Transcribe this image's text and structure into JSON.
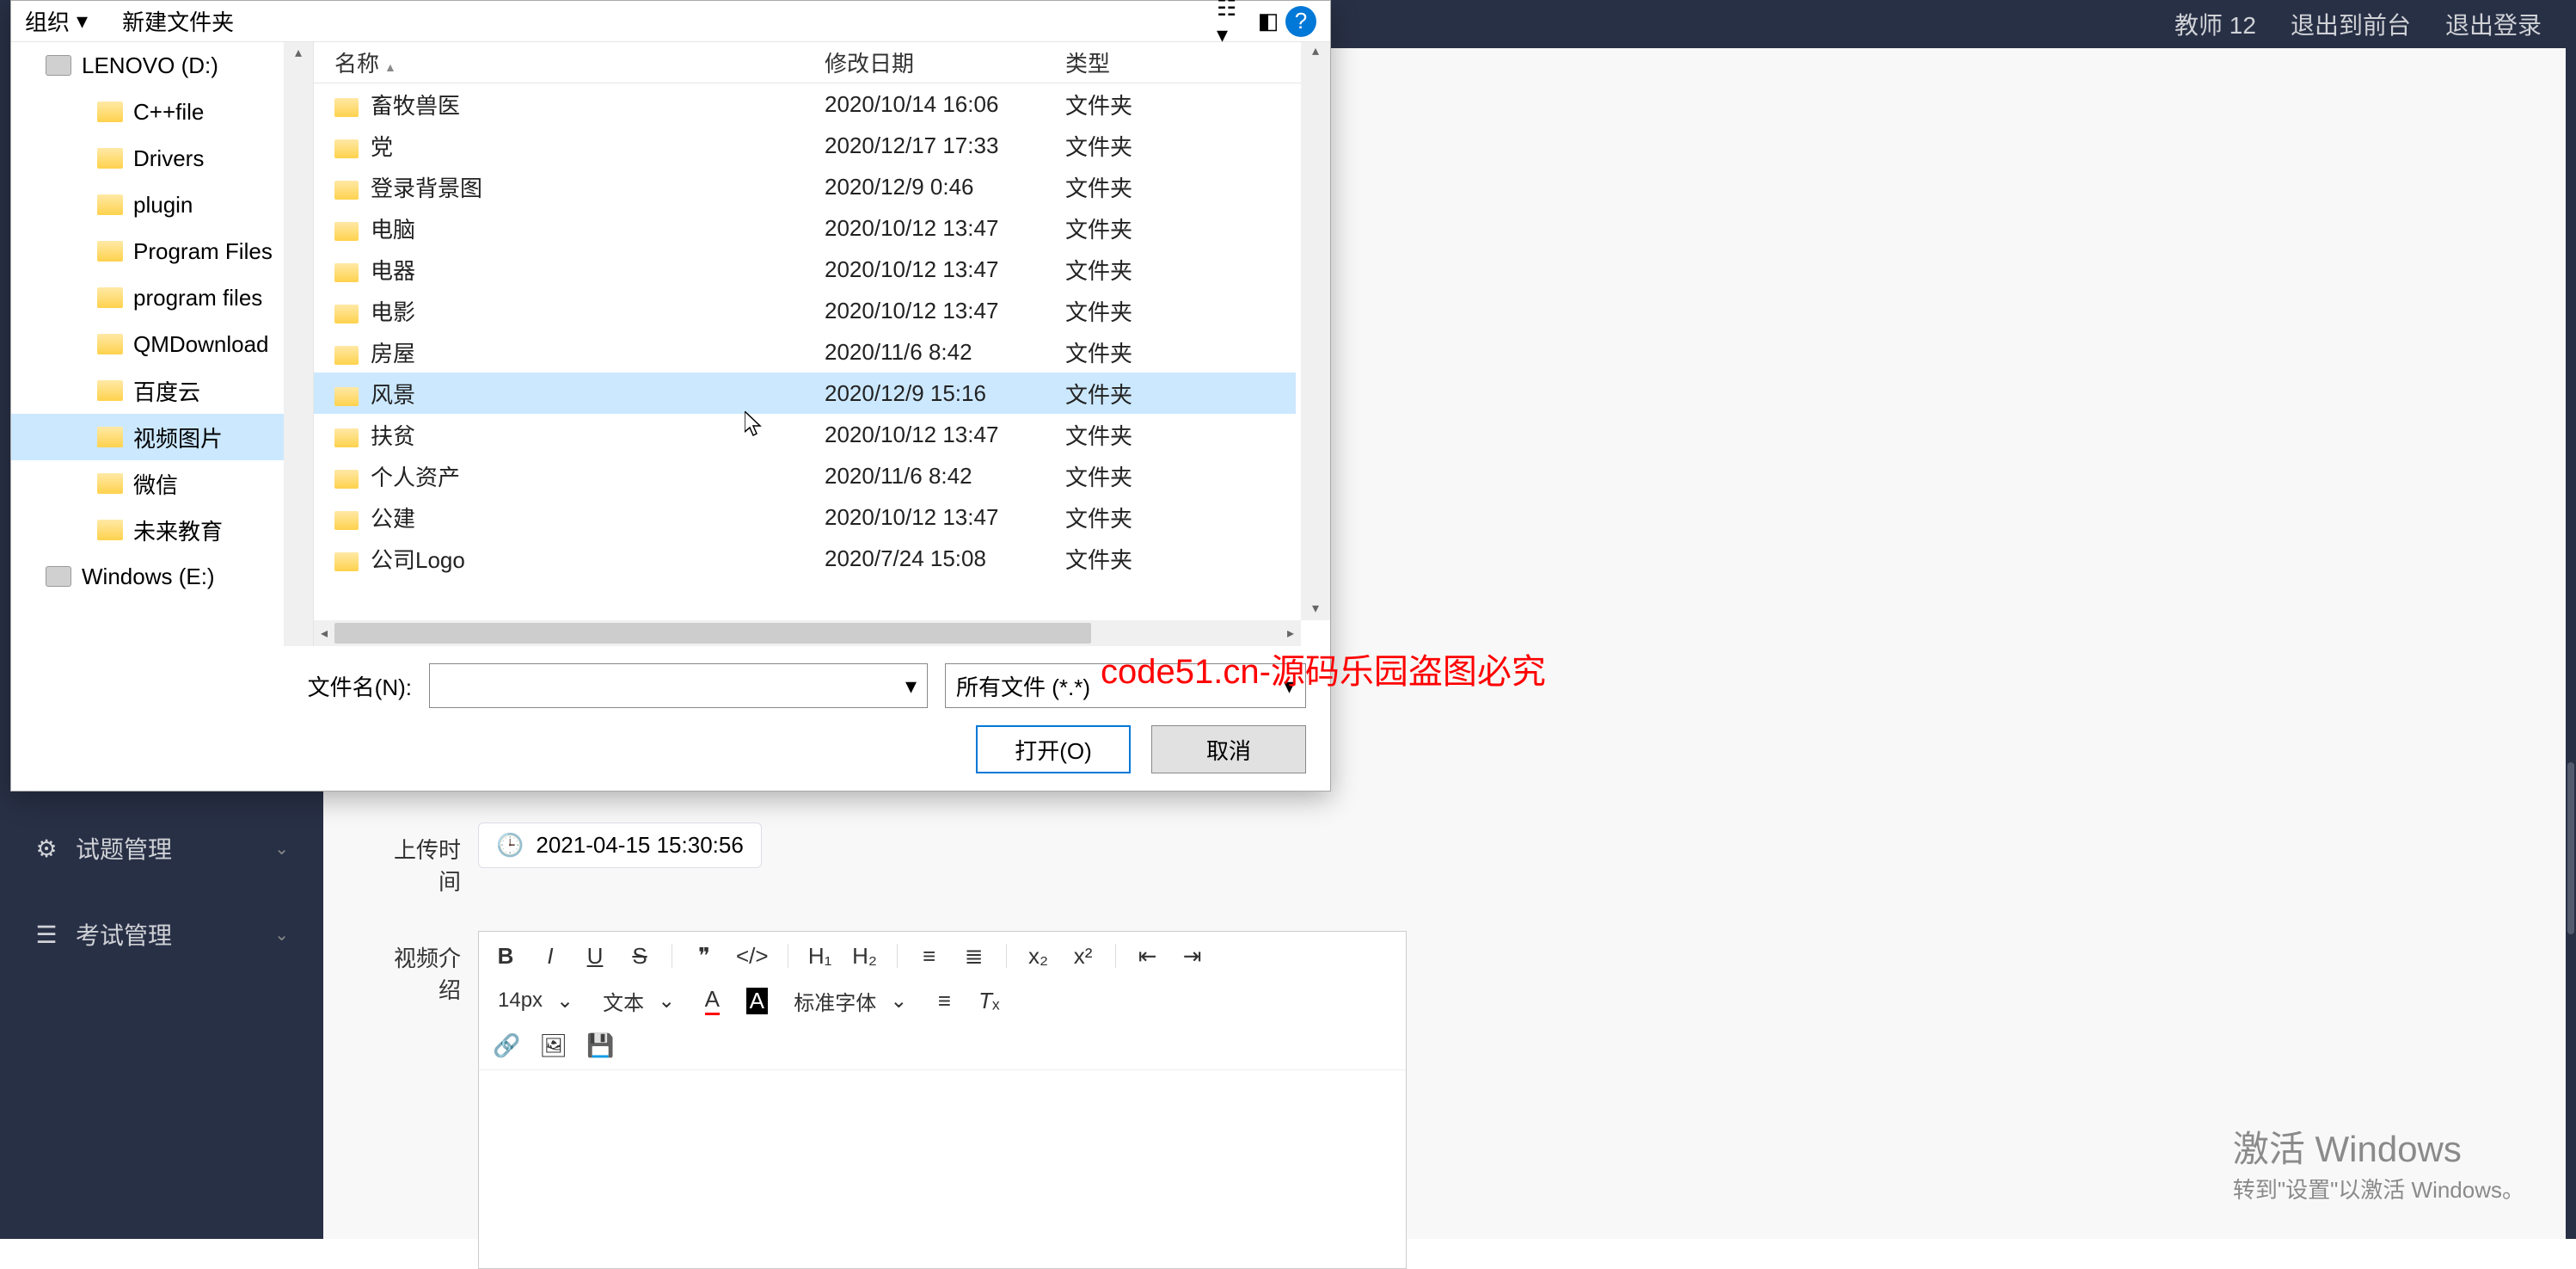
{
  "watermark_text": "code51.cn",
  "topbar": {
    "user": "教师 12",
    "to_front": "退出到前台",
    "logout": "退出登录"
  },
  "sidebar": {
    "items": [
      {
        "icon": "gear",
        "label": "试题管理"
      },
      {
        "icon": "menu",
        "label": "考试管理"
      }
    ]
  },
  "form": {
    "upload_time_label": "上传时间",
    "upload_time_value": "2021-04-15 15:30:56",
    "video_intro_label": "视频介绍"
  },
  "editor": {
    "font_size": "14px",
    "format": "文本",
    "font_family": "标准字体"
  },
  "dialog": {
    "toolbar": {
      "organize": "组织",
      "new_folder": "新建文件夹"
    },
    "tree": {
      "drive1": "LENOVO (D:)",
      "folders": [
        "C++file",
        "Drivers",
        "plugin",
        "Program Files",
        "program files",
        "QMDownload",
        "百度云",
        "视频图片",
        "微信",
        "未来教育"
      ],
      "drive2": "Windows (E:)",
      "selected_index": 7
    },
    "columns": {
      "name": "名称",
      "date": "修改日期",
      "type": "类型"
    },
    "rows": [
      {
        "name": "畜牧兽医",
        "date": "2020/10/14 16:06",
        "type": "文件夹"
      },
      {
        "name": "党",
        "date": "2020/12/17 17:33",
        "type": "文件夹"
      },
      {
        "name": "登录背景图",
        "date": "2020/12/9 0:46",
        "type": "文件夹"
      },
      {
        "name": "电脑",
        "date": "2020/10/12 13:47",
        "type": "文件夹"
      },
      {
        "name": "电器",
        "date": "2020/10/12 13:47",
        "type": "文件夹"
      },
      {
        "name": "电影",
        "date": "2020/10/12 13:47",
        "type": "文件夹"
      },
      {
        "name": "房屋",
        "date": "2020/11/6 8:42",
        "type": "文件夹"
      },
      {
        "name": "风景",
        "date": "2020/12/9 15:16",
        "type": "文件夹"
      },
      {
        "name": "扶贫",
        "date": "2020/10/12 13:47",
        "type": "文件夹"
      },
      {
        "name": "个人资产",
        "date": "2020/11/6 8:42",
        "type": "文件夹"
      },
      {
        "name": "公建",
        "date": "2020/10/12 13:47",
        "type": "文件夹"
      },
      {
        "name": "公司Logo",
        "date": "2020/7/24 15:08",
        "type": "文件夹"
      }
    ],
    "hover_index": 7,
    "footer": {
      "filename_label": "文件名(N):",
      "filename_value": "",
      "filter": "所有文件 (*.*)",
      "open": "打开(O)",
      "cancel": "取消"
    }
  },
  "overlay_text": "code51.cn-源码乐园盗图必究",
  "activate": {
    "line1": "激活 Windows",
    "line2": "转到\"设置\"以激活 Windows。"
  }
}
